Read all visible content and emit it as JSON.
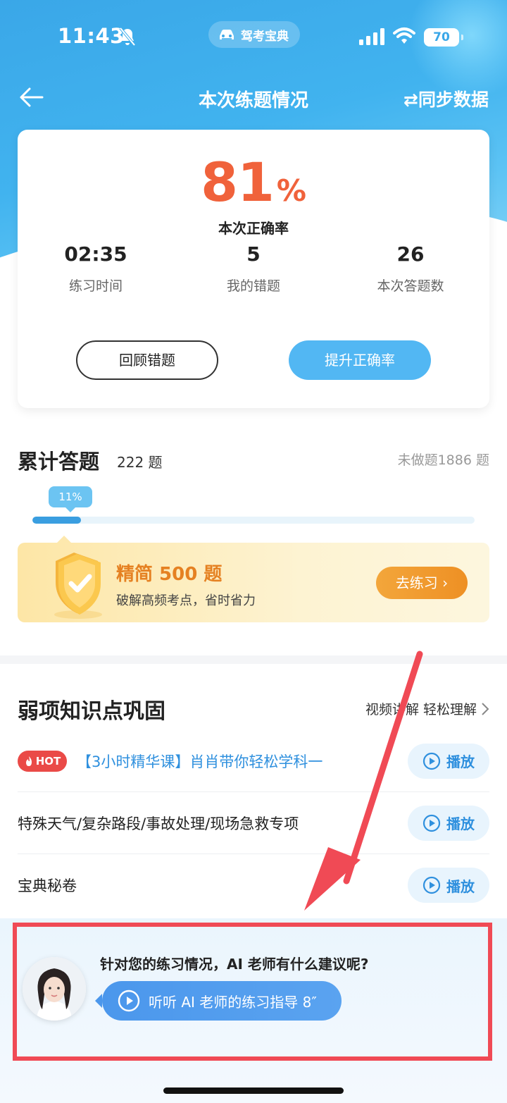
{
  "status_bar": {
    "time": "11:43",
    "app_name": "驾考宝典",
    "battery": "70"
  },
  "nav": {
    "title": "本次练题情况",
    "sync_label": "⇄同步数据"
  },
  "summary": {
    "accuracy_value": "81",
    "accuracy_unit": "%",
    "accuracy_label": "本次正确率",
    "stats": [
      {
        "value": "02:35",
        "label": "练习时间"
      },
      {
        "value": "5",
        "label": "我的错题"
      },
      {
        "value": "26",
        "label": "本次答题数"
      }
    ],
    "review_button": "回顾错题",
    "improve_button": "提升正确率"
  },
  "cumulative": {
    "title": "累计答题",
    "count": "222 题",
    "undone": "未做题1886 题",
    "progress_label": "11%",
    "progress_fraction": 0.11
  },
  "promo": {
    "title": "精简 500 题",
    "subtitle": "破解高频考点，省时省力",
    "button": "去练习"
  },
  "weak_points": {
    "title": "弱项知识点巩固",
    "link": "视频讲解 轻松理解",
    "play_label": "播放",
    "hot_label": "HOT",
    "items": [
      {
        "text": "【3小时精华课】肖肖带你轻松学科一",
        "hot": true
      },
      {
        "text": "特殊天气/复杂路段/事故处理/现场急救专项",
        "hot": false
      },
      {
        "text": "宝典秘卷",
        "hot": false
      }
    ]
  },
  "ai_teacher": {
    "question": "针对您的练习情况，AI 老师有什么建议呢?",
    "play_label": "听听 AI 老师的练习指导 8″"
  },
  "colors": {
    "accent_blue": "#52b7f3",
    "accuracy_orange": "#f0623b",
    "promo_orange": "#e58122",
    "hot_red": "#ea4a47",
    "annotation_red": "#f04a55"
  }
}
